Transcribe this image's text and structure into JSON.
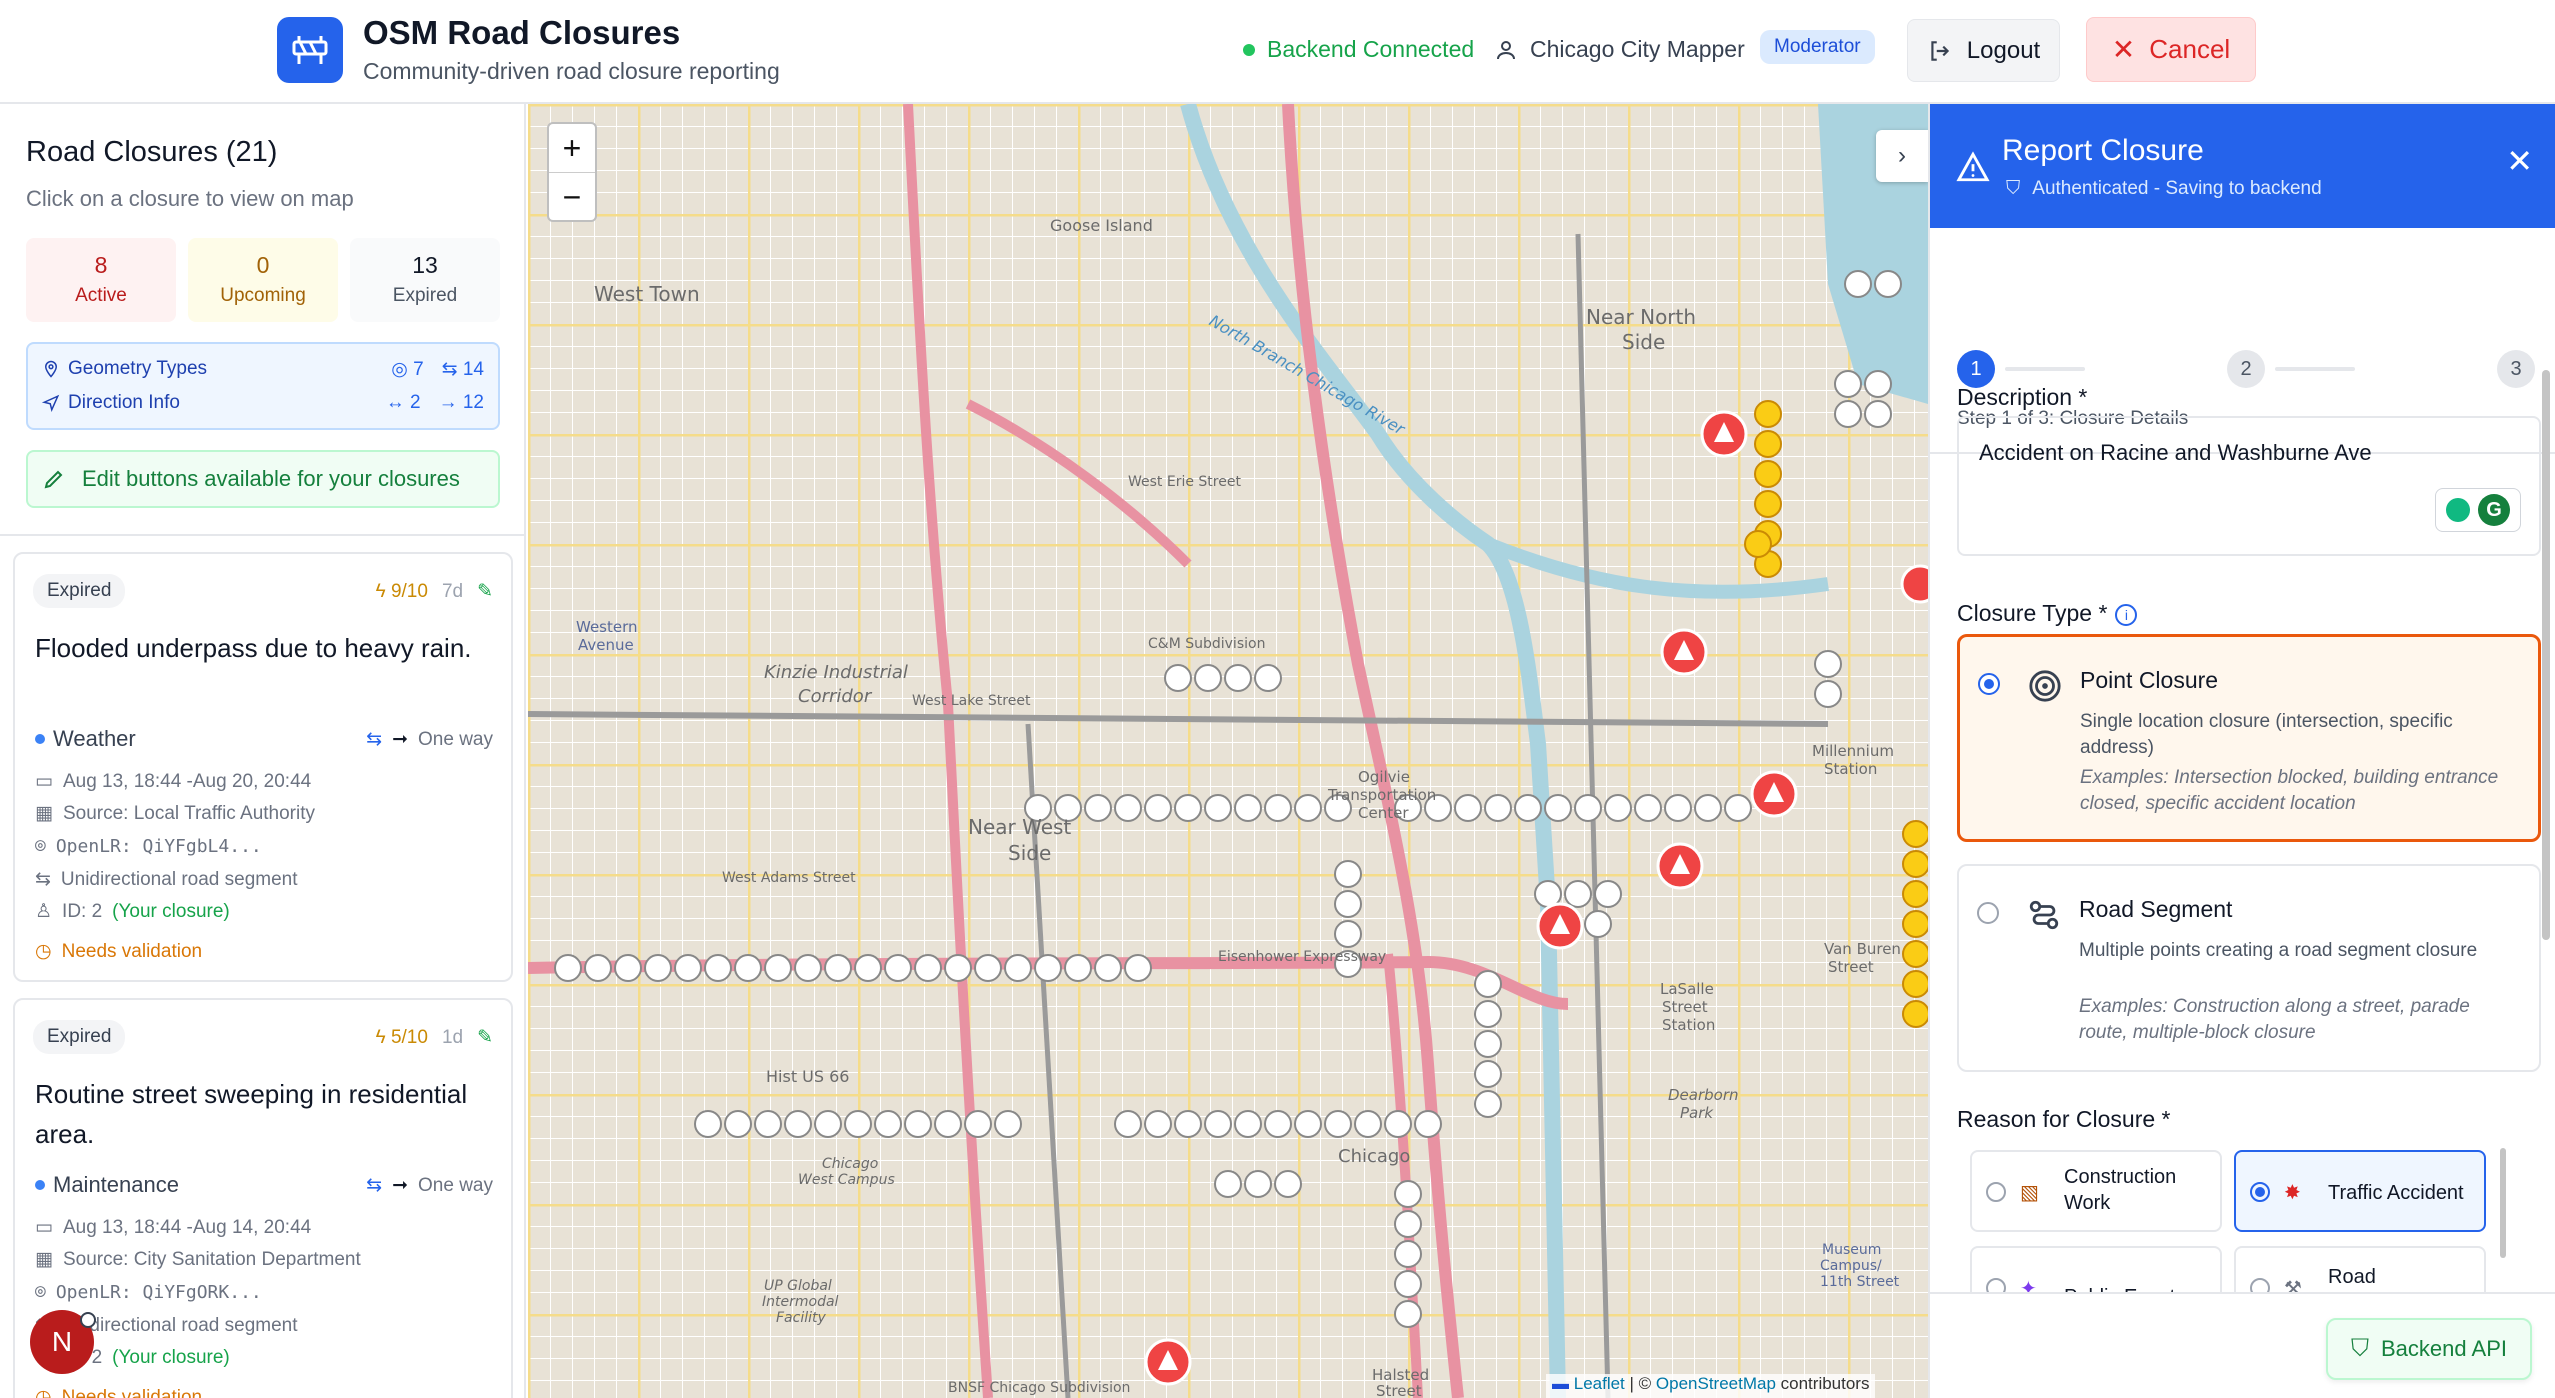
{
  "header": {
    "title": "OSM Road Closures",
    "subtitle": "Community-driven road closure reporting",
    "backend_status": "Backend Connected",
    "user_name": "Chicago City Mapper",
    "role": "Moderator",
    "logout_label": "Logout",
    "cancel_label": "Cancel"
  },
  "sidebar": {
    "title": "Road Closures (21)",
    "subtitle": "Click on a closure to view on map",
    "stats": [
      {
        "value": "8",
        "label": "Active"
      },
      {
        "value": "0",
        "label": "Upcoming"
      },
      {
        "value": "13",
        "label": "Expired"
      }
    ],
    "geometry": {
      "label": "Geometry Types",
      "point_count": "7",
      "segment_count": "14",
      "direction_label": "Direction Info",
      "bidirectional": "↔ 2",
      "oneway": "→ 12"
    },
    "edit_notice": "Edit buttons available for your closures",
    "cards": [
      {
        "status": "Expired",
        "score": "9/10",
        "age": "7d",
        "title": "Flooded underpass due to heavy rain.",
        "category": "Weather",
        "direction": "One way",
        "dates": "Aug 13, 18:44 -Aug 20, 20:44",
        "source": "Source: Local Traffic Authority",
        "openlr": "OpenLR: QiYFgbL4...",
        "segment": "Unidirectional road segment",
        "id_label": "ID: 2",
        "owner": "(Your closure)",
        "validation": "Needs validation"
      },
      {
        "status": "Expired",
        "score": "5/10",
        "age": "1d",
        "title": "Routine street sweeping in residential area.",
        "category": "Maintenance",
        "direction": "One way",
        "dates": "Aug 13, 18:44 -Aug 14, 20:44",
        "source": "Source: City Sanitation Department",
        "openlr": "OpenLR: QiYFgORK...",
        "segment": "Unidirectional road segment",
        "id_label": "ID: 2",
        "owner": "(Your closure)",
        "validation": "Needs validation"
      }
    ],
    "avatar_letter": "N"
  },
  "map": {
    "zoom_in": "+",
    "zoom_out": "−",
    "collapse": "›",
    "labels": [
      "West Town",
      "Goose Island",
      "Near North Side",
      "Kinzie Industrial Corridor",
      "Near West Side",
      "Hist US 66",
      "West Lake Street",
      "West Adams Street",
      "West Erie Street",
      "Ogilvie Transportation Center",
      "Chicago",
      "Millennium Station",
      "LaSalle Street Station",
      "Van Buren Street",
      "Dearborn Park",
      "Halsted Street",
      "Chicago West Campus",
      "UP Global Intermodal Facility",
      "North Branch Chicago River",
      "C&M Subdivision",
      "BNSF Chicago Subdivision",
      "Western Avenue",
      "Eisenhower Expressway",
      "Museum Campus/11th Street"
    ],
    "attribution_leaflet": "Leaflet",
    "attribution_sep": " | © ",
    "attribution_osm": "OpenStreetMap",
    "attribution_tail": " contributors"
  },
  "panel": {
    "title": "Report Closure",
    "subtitle": "Authenticated - Saving to backend",
    "steps": [
      "1",
      "2",
      "3"
    ],
    "step_label": "Step 1 of 3: Closure Details",
    "description_label": "Description *",
    "description_value": "Accident on Racine and Washburne Ave",
    "closure_type_label": "Closure Type *",
    "point": {
      "title": "Point Closure",
      "desc": "Single location closure (intersection, specific address)",
      "examples": "Examples: Intersection blocked, building entrance closed, specific accident location"
    },
    "segment": {
      "title": "Road Segment",
      "desc": "Multiple points creating a road segment closure",
      "examples": "Examples: Construction along a street, parade route, multiple-block closure"
    },
    "reason_label": "Reason for Closure *",
    "reasons": [
      "Construction Work",
      "Traffic Accident",
      "Public Event",
      "Road"
    ],
    "backend_api": "Backend API"
  },
  "colors": {
    "primary": "#2563eb",
    "danger": "#dc2626",
    "success": "#16a34a",
    "warning": "#d97706",
    "selected_bg": "#fff7ed",
    "selected_border": "#ea580c"
  }
}
